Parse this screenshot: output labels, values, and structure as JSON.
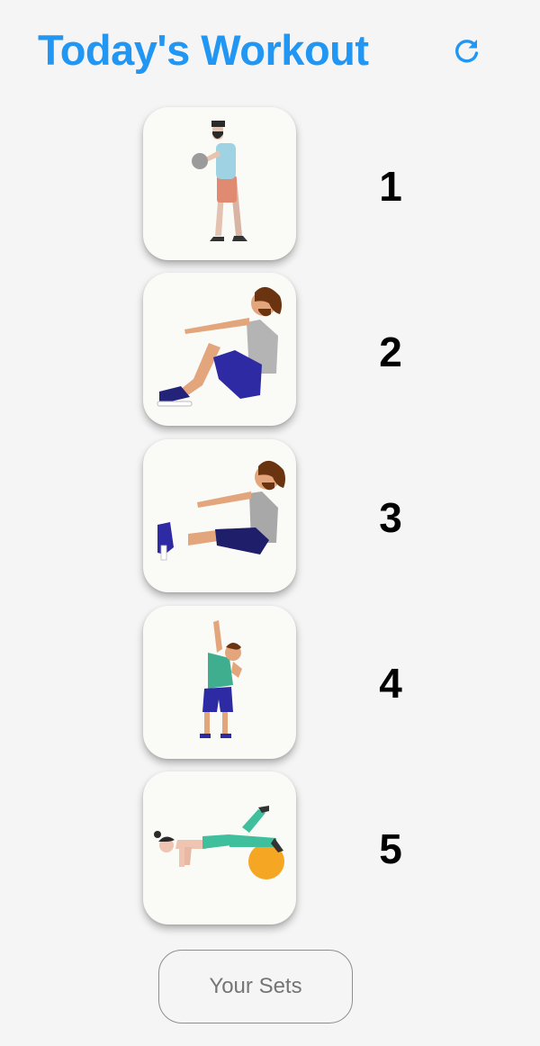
{
  "header": {
    "title": "Today's Workout",
    "refresh_icon": "refresh-icon"
  },
  "workouts": [
    {
      "number": "1",
      "illustration": "man-standing-holding-dumbbell"
    },
    {
      "number": "2",
      "illustration": "man-sit-up-knees-bent"
    },
    {
      "number": "3",
      "illustration": "man-v-sit-legs-extended"
    },
    {
      "number": "4",
      "illustration": "man-standing-side-stretch"
    },
    {
      "number": "5",
      "illustration": "woman-plank-on-exercise-ball"
    }
  ],
  "footer": {
    "sets_button_label": "Your Sets"
  },
  "colors": {
    "accent": "#2196f3",
    "card_background": "#fafaf7",
    "page_background": "#f5f5f5",
    "button_border": "#8e8e8e",
    "button_text": "#757575"
  }
}
